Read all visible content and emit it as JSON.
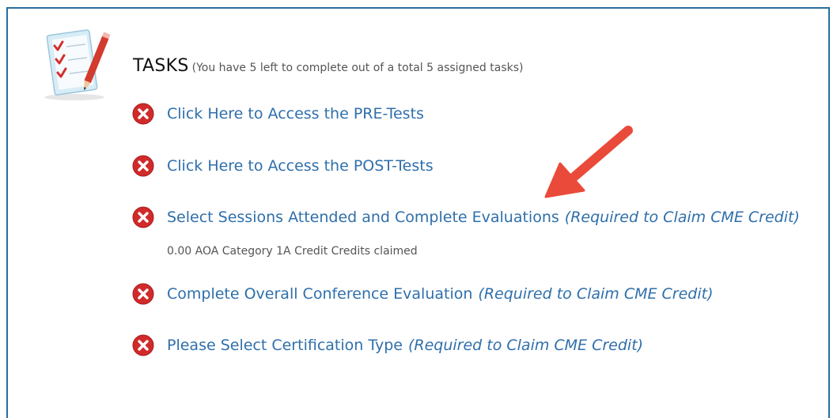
{
  "colors": {
    "frame_border": "#2a6e9e",
    "link": "#2f6faa",
    "icon_red": "#d02a2a",
    "arrow": "#ea4a3a"
  },
  "header": {
    "icon": "clipboard-checklist-icon",
    "title": "TASKS",
    "subtitle": "(You have 5 left to complete out of a total 5 assigned tasks)"
  },
  "tasks": [
    {
      "status_icon": "x-circle-icon",
      "label": "Click Here to Access the PRE-Tests",
      "note": ""
    },
    {
      "status_icon": "x-circle-icon",
      "label": "Click Here to Access the POST-Tests",
      "note": ""
    },
    {
      "status_icon": "x-circle-icon",
      "label": "Select Sessions Attended and Complete Evaluations",
      "note": "(Required to Claim CME Credit)",
      "sub": "0.00 AOA Category 1A Credit Credits claimed"
    },
    {
      "status_icon": "x-circle-icon",
      "label": "Complete Overall Conference Evaluation",
      "note": "(Required to Claim CME Credit)"
    },
    {
      "status_icon": "x-circle-icon",
      "label": "Please Select Certification Type",
      "note": "(Required to Claim CME Credit)"
    }
  ],
  "annotation": {
    "icon": "red-arrow-icon"
  }
}
